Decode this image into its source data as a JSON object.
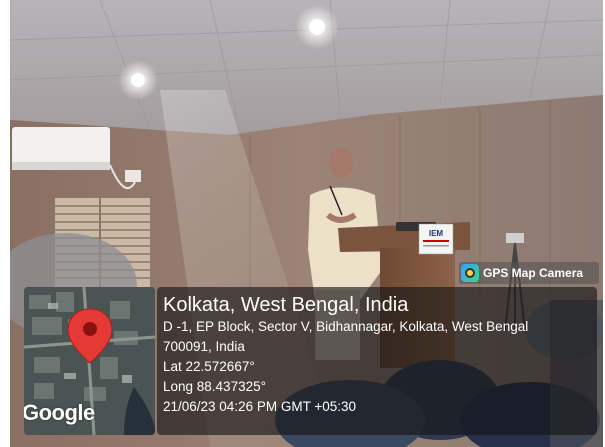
{
  "podium_sign": "IEM",
  "gps_badge": {
    "app_name": "GPS Map Camera",
    "icon": "gps-map-camera-logo-icon"
  },
  "map": {
    "wordmark": "Google",
    "pin_icon": "map-pin-icon"
  },
  "location": {
    "city": "Kolkata, West Bengal, India",
    "address_line1": "D -1, EP Block, Sector V, Bidhannagar, Kolkata, West Bengal",
    "address_line2": "700091, India",
    "latitude": "Lat 22.572667°",
    "longitude": "Long 88.437325°",
    "timestamp": "21/06/23 04:26 PM GMT +05:30"
  }
}
